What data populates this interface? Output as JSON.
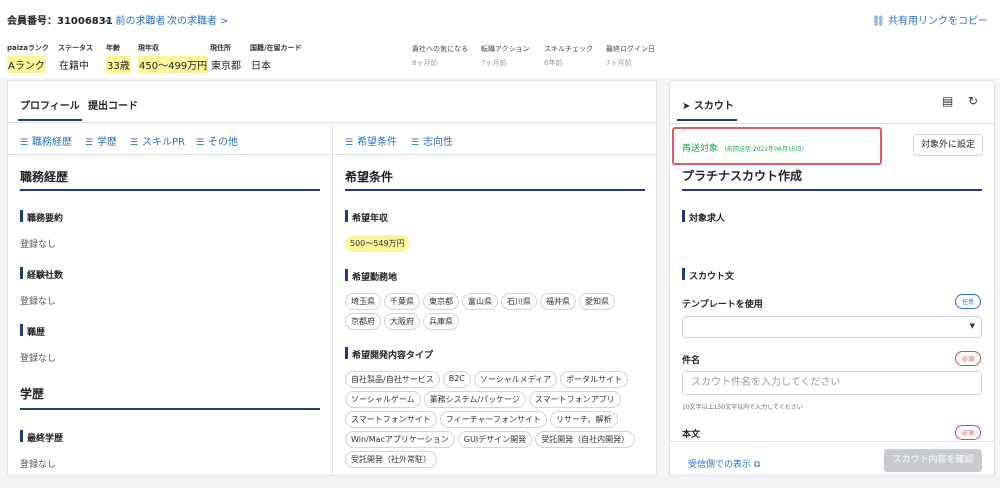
{
  "header": {
    "member_label": "会員番号：31006831",
    "prev_link": "< 前の求職者",
    "next_link": "次の求職者 >",
    "share_link": "共有用リンクをコピー"
  },
  "meta": [
    {
      "key": "paizaランク",
      "value": "Aランク",
      "highlight": true
    },
    {
      "key": "ステータス",
      "value": "在籍中",
      "highlight": false
    },
    {
      "key": "年齢",
      "value": "33歳",
      "highlight": true
    },
    {
      "key": "現年収",
      "value": "450〜499万円",
      "highlight": true
    },
    {
      "key": "現住所",
      "value": "東京都",
      "highlight": false
    },
    {
      "key": "国籍/在留カード",
      "value": "日本",
      "highlight": false
    }
  ],
  "activity": [
    {
      "key": "貴社への気になる",
      "value": "8ヶ月前"
    },
    {
      "key": "転職アクション",
      "value": "7ヶ月前"
    },
    {
      "key": "スキルチェック",
      "value": "6年前"
    },
    {
      "key": "最終ログイン日",
      "value": "7ヶ月前"
    }
  ],
  "left_panel": {
    "tabs": [
      "プロフィール",
      "提出コード"
    ],
    "left_subnav": [
      "職務経歴",
      "学歴",
      "スキルPR",
      "その他"
    ],
    "right_subnav": [
      "希望条件",
      "志向性"
    ],
    "career": {
      "title": "職務経歴",
      "summary_label": "職務要約",
      "summary_value": "登録なし",
      "companies_label": "経験社数",
      "companies_value": "登録なし",
      "history_label": "職歴",
      "history_value": "登録なし"
    },
    "education": {
      "title": "学歴",
      "final_label": "最終学歴",
      "final_value": "登録なし"
    },
    "desired": {
      "title": "希望条件",
      "salary_label": "希望年収",
      "salary_value": "500〜549万円",
      "location_label": "希望勤務地",
      "locations": [
        "埼玉県",
        "千葉県",
        "東京都",
        "富山県",
        "石川県",
        "福井県",
        "愛知県",
        "京都府",
        "大阪府",
        "兵庫県"
      ],
      "dev_label": "希望開発内容タイプ",
      "dev_types": [
        "自社製品/自社サービス",
        "B2C",
        "ソーシャルメディア",
        "ポータルサイト",
        "ソーシャルゲーム",
        "業務システム/パッケージ",
        "スマートフォンアプリ",
        "スマートフォンサイト",
        "フィーチャーフォンサイト",
        "リサーチ、解析",
        "Win/Macアプリケーション",
        "GUIデザイン開発",
        "受託開発（自社内開発）",
        "受託開発（社外常駐）"
      ]
    }
  },
  "right_panel": {
    "tab": "スカウト",
    "resend_text": "再送対象",
    "resend_note": "（前回送信:2022年06月15日）",
    "exclude_button": "対象外に設定",
    "title": "プラチナスカウト作成",
    "target_label": "対象求人",
    "scout_text_label": "スカウト文",
    "template_label": "テンプレートを使用",
    "optional_badge": "任意",
    "subject_label": "件名",
    "required_badge": "必須",
    "subject_placeholder": "スカウト件名を入力してください",
    "subject_hint": "10文字以上150文字以内で入力してください",
    "body_label": "本文",
    "body_badge": "必須",
    "preview_link": "受信側での表示",
    "confirm_button": "スカウト内容を確認"
  }
}
